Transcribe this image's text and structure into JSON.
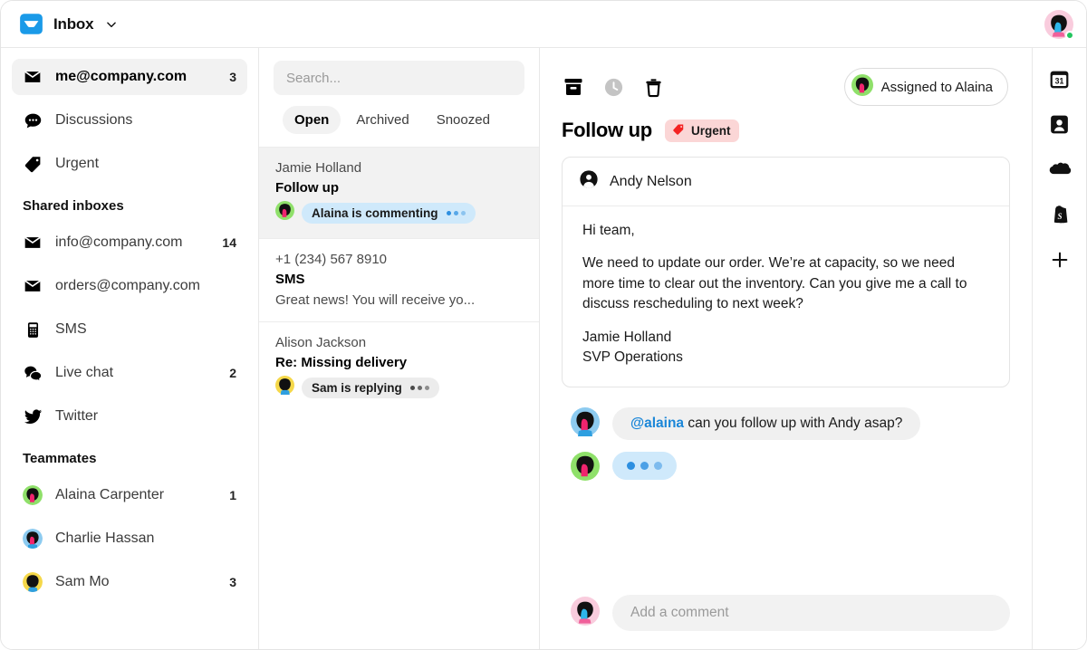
{
  "app": {
    "brand_icon": "inbox-icon",
    "title": "Inbox",
    "brand_color": "#1a9ae8",
    "chevron": "chevron-down-icon"
  },
  "sidebar": {
    "primary": [
      {
        "icon": "envelope-icon",
        "label": "me@company.com",
        "count": "3",
        "selected": true
      },
      {
        "icon": "chat-bubble-icon",
        "label": "Discussions",
        "count": "",
        "selected": false
      },
      {
        "icon": "tag-icon",
        "label": "Urgent",
        "count": "",
        "selected": false
      }
    ],
    "shared_title": "Shared inboxes",
    "shared": [
      {
        "icon": "envelope-icon",
        "label": "info@company.com",
        "count": "14"
      },
      {
        "icon": "envelope-icon",
        "label": "orders@company.com",
        "count": ""
      },
      {
        "icon": "mobile-phone-icon",
        "label": "SMS",
        "count": ""
      },
      {
        "icon": "live-chat-icon",
        "label": "Live chat",
        "count": "2"
      },
      {
        "icon": "twitter-bird-icon",
        "label": "Twitter",
        "count": ""
      }
    ],
    "teammates_title": "Teammates",
    "teammates": [
      {
        "label": "Alaina Carpenter",
        "count": "1",
        "avatar": "alaina"
      },
      {
        "label": "Charlie Hassan",
        "count": "",
        "avatar": "charlie"
      },
      {
        "label": "Sam Mo",
        "count": "3",
        "avatar": "sam"
      }
    ]
  },
  "list": {
    "search": {
      "placeholder": "Search...",
      "value": ""
    },
    "tabs": [
      {
        "label": "Open",
        "active": true
      },
      {
        "label": "Archived",
        "active": false
      },
      {
        "label": "Snoozed",
        "active": false
      }
    ],
    "conversations": [
      {
        "from": "Jamie Holland",
        "subject": "Follow up",
        "status_text": "Alaina is commenting",
        "status_style": "blue",
        "avatar": "alaina",
        "preview": "",
        "active": true
      },
      {
        "from": "+1 (234) 567 8910",
        "subject": "SMS",
        "status_text": "",
        "status_style": "",
        "avatar": "",
        "preview": "Great news! You will receive yo...",
        "active": false
      },
      {
        "from": "Alison Jackson",
        "subject": "Re: Missing delivery",
        "status_text": "Sam is replying",
        "status_style": "gray",
        "avatar": "sam",
        "preview": "",
        "active": false
      }
    ]
  },
  "main": {
    "toolbar": {
      "archive_icon": "archive-box-icon",
      "snooze_icon": "clock-icon",
      "delete_icon": "trash-icon",
      "assigned_label": "Assigned to Alaina",
      "assigned_avatar": "alaina"
    },
    "subject": "Follow up",
    "tag": {
      "label": "Urgent",
      "icon": "tag-icon",
      "bg": "#fbd6d6",
      "icon_color": "#f42424"
    },
    "message": {
      "author": "Andy Nelson",
      "author_icon": "contact-avatar-icon",
      "paragraphs": [
        "Hi team,",
        "We need to update our order. We’re at capacity, so we need more time to clear out the inventory. Can you give me a call to discuss rescheduling to next week?"
      ],
      "signature_name": "Jamie Holland",
      "signature_role": "SVP Operations"
    },
    "comments": [
      {
        "avatar": "charlie",
        "mention": "@alaina",
        "text": " can you follow up with Andy asap?",
        "typing": false
      },
      {
        "avatar": "alaina",
        "mention": "",
        "text": "",
        "typing": true
      }
    ],
    "composer": {
      "avatar": "me",
      "placeholder": "Add a comment",
      "value": ""
    }
  },
  "rail": {
    "items": [
      {
        "icon": "calendar-31-icon"
      },
      {
        "icon": "contact-card-icon"
      },
      {
        "icon": "salesforce-cloud-icon"
      },
      {
        "icon": "shopify-bag-icon"
      },
      {
        "icon": "plus-icon"
      }
    ]
  },
  "user": {
    "avatar": "me",
    "online": true
  }
}
